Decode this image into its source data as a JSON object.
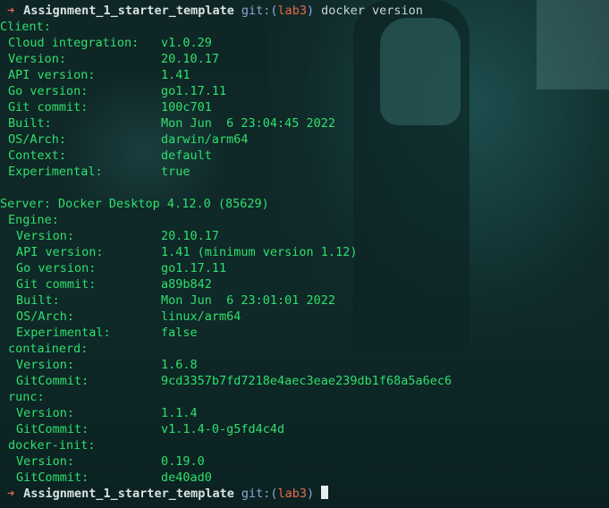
{
  "prompt": {
    "arrow": "➜",
    "cwd": "Assignment_1_starter_template",
    "git_prefix": "git:(",
    "branch": "lab3",
    "git_suffix": ")",
    "command": "docker version"
  },
  "client": {
    "header": "Client:",
    "rows": [
      {
        "k": "Cloud integration:",
        "v": "v1.0.29"
      },
      {
        "k": "Version:",
        "v": "20.10.17"
      },
      {
        "k": "API version:",
        "v": "1.41"
      },
      {
        "k": "Go version:",
        "v": "go1.17.11"
      },
      {
        "k": "Git commit:",
        "v": "100c701"
      },
      {
        "k": "Built:",
        "v": "Mon Jun  6 23:04:45 2022"
      },
      {
        "k": "OS/Arch:",
        "v": "darwin/arm64"
      },
      {
        "k": "Context:",
        "v": "default"
      },
      {
        "k": "Experimental:",
        "v": "true"
      }
    ]
  },
  "server": {
    "header": "Server: Docker Desktop 4.12.0 (85629)",
    "engine": {
      "header": "Engine:",
      "rows": [
        {
          "k": "Version:",
          "v": "20.10.17"
        },
        {
          "k": "API version:",
          "v": "1.41 (minimum version 1.12)"
        },
        {
          "k": "Go version:",
          "v": "go1.17.11"
        },
        {
          "k": "Git commit:",
          "v": "a89b842"
        },
        {
          "k": "Built:",
          "v": "Mon Jun  6 23:01:01 2022"
        },
        {
          "k": "OS/Arch:",
          "v": "linux/arm64"
        },
        {
          "k": "Experimental:",
          "v": "false"
        }
      ]
    },
    "containerd": {
      "header": "containerd:",
      "rows": [
        {
          "k": "Version:",
          "v": "1.6.8"
        },
        {
          "k": "GitCommit:",
          "v": "9cd3357b7fd7218e4aec3eae239db1f68a5a6ec6"
        }
      ]
    },
    "runc": {
      "header": "runc:",
      "rows": [
        {
          "k": "Version:",
          "v": "1.1.4"
        },
        {
          "k": "GitCommit:",
          "v": "v1.1.4-0-g5fd4c4d"
        }
      ]
    },
    "docker_init": {
      "header": "docker-init:",
      "rows": [
        {
          "k": "Version:",
          "v": "0.19.0"
        },
        {
          "k": "GitCommit:",
          "v": "de40ad0"
        }
      ]
    }
  },
  "colors": {
    "output_green": "#2ee06b",
    "arrow_red": "#e86a4a",
    "git_blue": "#8aa8d8"
  }
}
